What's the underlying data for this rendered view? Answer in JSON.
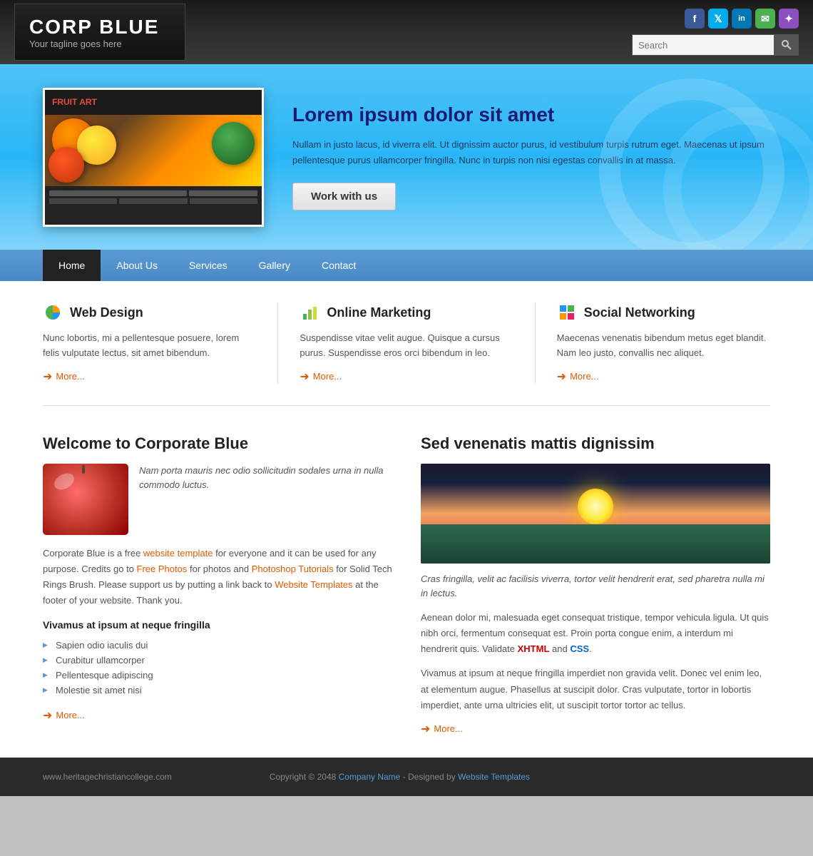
{
  "header": {
    "logo_title": "CORP BLUE",
    "logo_tagline": "Your tagline goes here",
    "search_placeholder": "Search",
    "social_icons": [
      {
        "name": "facebook",
        "label": "f",
        "class": "si-fb"
      },
      {
        "name": "twitter",
        "label": "t",
        "class": "si-tw"
      },
      {
        "name": "linkedin",
        "label": "in",
        "class": "si-li"
      },
      {
        "name": "message",
        "label": "✉",
        "class": "si-msg"
      },
      {
        "name": "rss",
        "label": "✦",
        "class": "si-rss"
      }
    ]
  },
  "hero": {
    "heading": "Lorem ipsum dolor sit amet",
    "description": "Nullam in justo lacus, id viverra elit. Ut dignissim auctor purus, id vestibulum turpis rutrum eget. Maecenas ut ipsum pellentesque purus ullamcorper fringilla. Nunc in turpis non nisi egestas convallis in at massa.",
    "button_label": "Work with us",
    "fruit_label": "FRUIT ART"
  },
  "nav": {
    "items": [
      {
        "label": "Home",
        "active": true
      },
      {
        "label": "About Us",
        "active": false
      },
      {
        "label": "Services",
        "active": false
      },
      {
        "label": "Gallery",
        "active": false
      },
      {
        "label": "Contact",
        "active": false
      }
    ]
  },
  "columns": [
    {
      "heading": "Web Design",
      "text": "Nunc lobortis, mi a pellentesque posuere, lorem felis vulputate lectus, sit amet bibendum.",
      "more": "More..."
    },
    {
      "heading": "Online Marketing",
      "text": "Suspendisse vitae velit augue. Quisque a cursus purus. Suspendisse eros orci bibendum in leo.",
      "more": "More..."
    },
    {
      "heading": "Social Networking",
      "text": "Maecenas venenatis bibendum metus eget blandit. Nam leo justo, convallis nec aliquet.",
      "more": "More..."
    }
  ],
  "welcome": {
    "heading": "Welcome to Corporate Blue",
    "quote": "Nam porta mauris nec odio sollicitudin sodales urna in nulla commodo luctus.",
    "text1": "Corporate Blue is a free ",
    "link1": "website template",
    "text2": " for everyone and it can be used for any purpose. Credits go to ",
    "link2": "Free Photos",
    "text3": " for photos and ",
    "link3": "Photoshop Tutorials",
    "text4": " for Solid Tech Rings Brush. Please support us by putting a link back to ",
    "link4": "Website Templates",
    "text5": " at the footer of your website. Thank you.",
    "subheading": "Vivamus at ipsum at neque fringilla",
    "bullets": [
      "Sapien odio iaculis dui",
      "Curabitur ullamcorper",
      "Pellentesque adipiscing",
      "Molestie sit amet nisi"
    ],
    "more": "More..."
  },
  "right_section": {
    "heading": "Sed venenatis mattis dignissim",
    "italic_text": "Cras fringilla, velit ac facilisis viverra, tortor velit hendrerit erat, sed pharetra nulla mi in lectus.",
    "text1": "Aenean dolor mi, malesuada eget consequat tristique, tempor vehicula ligula. Ut quis nibh orci, fermentum consequat est. Proin porta congue enim, a interdum mi hendrerit quis. Validate ",
    "xhtml_link": "XHTML",
    "text2": " and ",
    "css_link": "CSS",
    "text3": ".",
    "text4": "Vivamus at ipsum at neque fringilla imperdiet non gravida velit. Donec vel enim leo, at elementum augue. Phasellus at suscipit dolor. Cras vulputate, tortor in lobortis imperdiet, ante urna ultricies elit, ut suscipit tortor tortor ac tellus.",
    "more": "More..."
  },
  "footer": {
    "left_text": "www.heritagechristiancollege.com",
    "center_text1": "Copyright © 2048 ",
    "company_link": "Company Name",
    "center_text2": " - Designed by ",
    "design_link": "Website Templates"
  }
}
